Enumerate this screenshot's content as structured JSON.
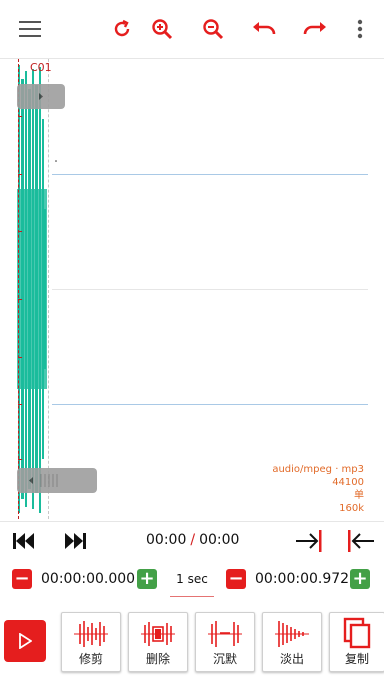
{
  "toolbar": {
    "icons": [
      "menu-icon",
      "refresh-icon",
      "zoom-in-icon",
      "zoom-out-icon",
      "undo-icon",
      "redo-icon",
      "more-vert-icon"
    ],
    "accent": "#e51e1e"
  },
  "waveform": {
    "marker_label": "C01",
    "wave_color": "#1abc9c",
    "file_info": {
      "mime": "audio/mpeg · mp3",
      "sample_rate": "44100",
      "channels": "单",
      "bitrate": "160k"
    }
  },
  "transport": {
    "current": "00:00",
    "separator": "/",
    "total": "00:00"
  },
  "selection": {
    "start": "00:00:00.000",
    "step": "1 sec",
    "end": "00:00:00.972",
    "minus": "−",
    "plus": "+"
  },
  "tools": [
    {
      "label": "修剪"
    },
    {
      "label": "删除"
    },
    {
      "label": "沉默"
    },
    {
      "label": "淡出"
    },
    {
      "label": "复制"
    }
  ]
}
